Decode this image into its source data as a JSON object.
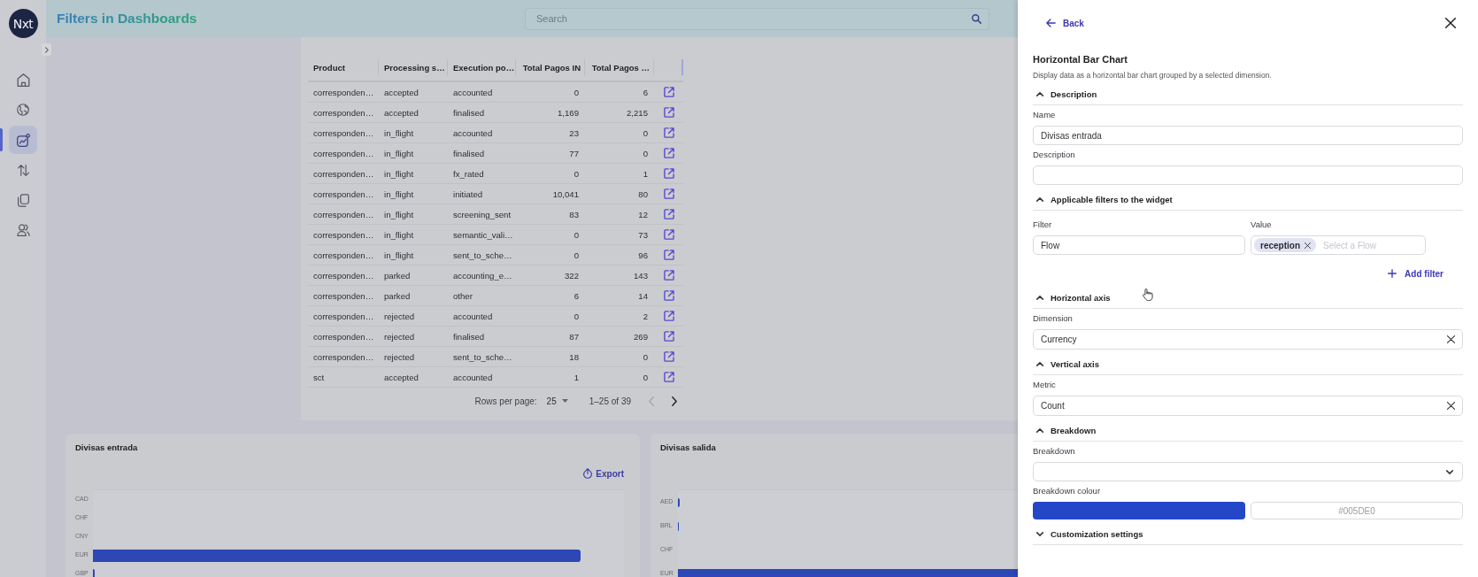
{
  "app": {
    "logo": "Nxt",
    "title": "Filters in Dashboards",
    "search": {
      "placeholder": "Search"
    }
  },
  "sidebar": {
    "items": [
      {
        "kind": "home",
        "selected": false
      },
      {
        "kind": "globe",
        "selected": false
      },
      {
        "kind": "chart",
        "selected": true
      },
      {
        "kind": "transfer",
        "selected": false
      },
      {
        "kind": "documents",
        "selected": false
      },
      {
        "kind": "users",
        "selected": false
      }
    ]
  },
  "table": {
    "columns": [
      {
        "label": "Product",
        "kind": "text"
      },
      {
        "label": "Processing s…",
        "kind": "text"
      },
      {
        "label": "Execution po…",
        "kind": "text"
      },
      {
        "label": "Total Pagos IN",
        "kind": "number"
      },
      {
        "label": "Total Pagos …",
        "kind": "number"
      }
    ],
    "rows": [
      [
        "corresponden…",
        "accepted",
        "accounted",
        "0",
        "6"
      ],
      [
        "corresponden…",
        "accepted",
        "finalised",
        "1,169",
        "2,215"
      ],
      [
        "corresponden…",
        "in_flight",
        "accounted",
        "23",
        "0"
      ],
      [
        "corresponden…",
        "in_flight",
        "finalised",
        "77",
        "0"
      ],
      [
        "corresponden…",
        "in_flight",
        "fx_rated",
        "0",
        "1"
      ],
      [
        "corresponden…",
        "in_flight",
        "initiated",
        "10,041",
        "80"
      ],
      [
        "corresponden…",
        "in_flight",
        "screening_sent",
        "83",
        "12"
      ],
      [
        "corresponden…",
        "in_flight",
        "semantic_vali…",
        "0",
        "73"
      ],
      [
        "corresponden…",
        "in_flight",
        "sent_to_sche…",
        "0",
        "96"
      ],
      [
        "corresponden…",
        "parked",
        "accounting_e…",
        "322",
        "143"
      ],
      [
        "corresponden…",
        "parked",
        "other",
        "6",
        "14"
      ],
      [
        "corresponden…",
        "rejected",
        "accounted",
        "0",
        "2"
      ],
      [
        "corresponden…",
        "rejected",
        "finalised",
        "87",
        "269"
      ],
      [
        "corresponden…",
        "rejected",
        "sent_to_sche…",
        "18",
        "0"
      ],
      [
        "sct",
        "accepted",
        "accounted",
        "1",
        "0"
      ]
    ],
    "pagination": {
      "rows_per_page_label": "Rows per page:",
      "rows_per_page": "25",
      "range": "1–25 of 39",
      "previous_disabled": true,
      "next_disabled": false
    }
  },
  "charts": [
    {
      "title": "Divisas entrada",
      "export": "Export",
      "bar_labels": [
        "CAD",
        "CHF",
        "CNY",
        "EUR",
        "GBP"
      ]
    },
    {
      "title": "Divisas salida",
      "bar_labels": [
        "AED",
        "BRL",
        "CHF",
        "EUR"
      ]
    }
  ],
  "panel": {
    "back": "Back",
    "title": "Horizontal Bar Chart",
    "subtitle": "Display data as a horizontal bar chart grouped by a selected dimension.",
    "sections": [
      {
        "title": "Description",
        "expanded": true,
        "fields": [
          {
            "kind": "text",
            "label": "Name",
            "value": "Divisas entrada"
          },
          {
            "kind": "text",
            "label": "Description"
          }
        ]
      },
      {
        "title": "Applicable filters to the widget",
        "expanded": true,
        "filters": [
          {
            "filter_label": "Filter",
            "filter_value": "Flow",
            "value_label": "Value",
            "chips": [
              "reception"
            ],
            "placeholder": "Select a Flow"
          }
        ],
        "add_filter": "Add filter"
      },
      {
        "title": "Horizontal axis",
        "expanded": true,
        "fields": [
          {
            "kind": "clearable",
            "label": "Dimension",
            "value": "Currency"
          }
        ]
      },
      {
        "title": "Vertical axis",
        "expanded": true,
        "fields": [
          {
            "kind": "clearable",
            "label": "Metric",
            "value": "Count"
          }
        ]
      },
      {
        "title": "Breakdown",
        "expanded": true,
        "fields": [
          {
            "kind": "dropdown",
            "label": "Breakdown"
          },
          {
            "kind": "color",
            "label": "Breakdown colour",
            "color": "#2447c8",
            "placeholder": "#005DE0"
          }
        ]
      },
      {
        "title": "Customization settings",
        "expanded": false
      }
    ]
  }
}
